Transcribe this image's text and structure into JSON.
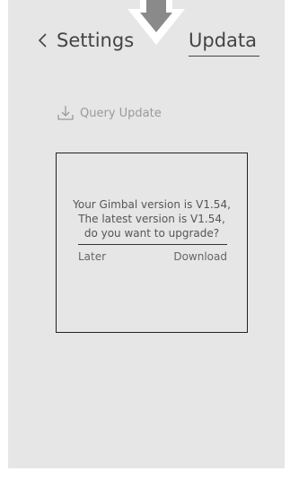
{
  "header": {
    "back_label": "Settings",
    "title": "Updata"
  },
  "query": {
    "label": "Query Update",
    "icon": "download-icon"
  },
  "dialog": {
    "line1": "Your Gimbal version is V1.54,",
    "line2": "The latest version is V1.54,",
    "line3": "do you want to upgrade?",
    "later_label": "Later",
    "download_label": "Download"
  },
  "colors": {
    "background": "#e6e6e6",
    "text": "#444444",
    "muted": "#9a9a9a",
    "border": "#222222"
  }
}
